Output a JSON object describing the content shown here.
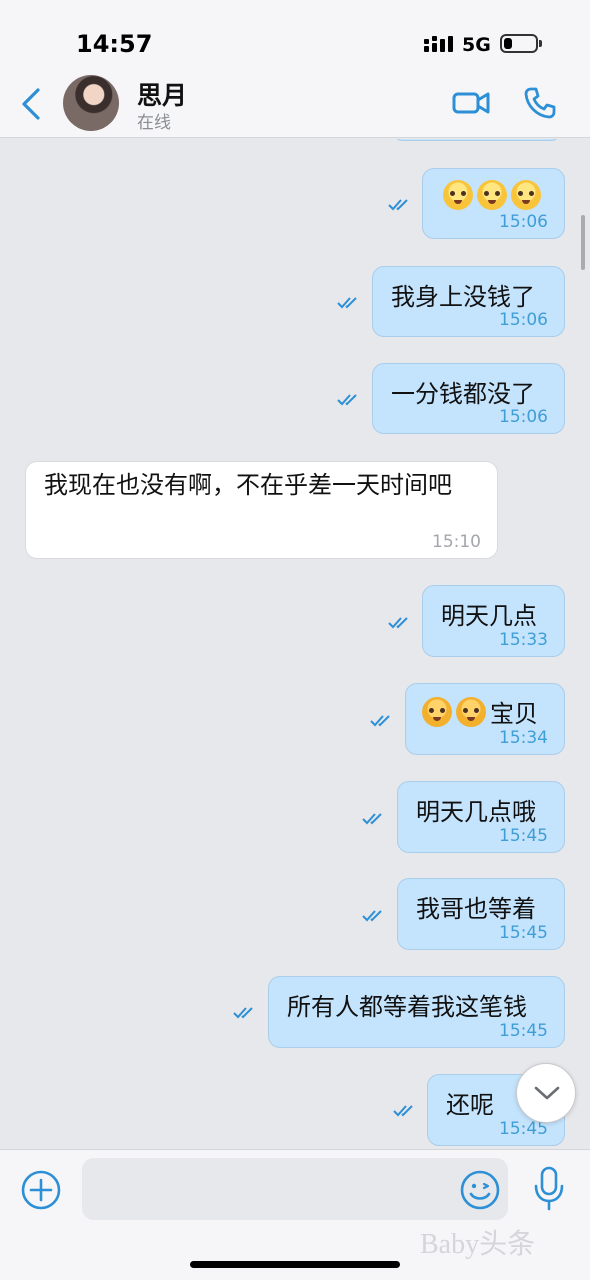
{
  "status_bar": {
    "time": "14:57",
    "network": "5G",
    "battery_level": 0.25
  },
  "header": {
    "contact_name": "思月",
    "contact_status": "在线",
    "back_icon": "chevron-left-icon",
    "video_icon": "video-camera-icon",
    "phone_icon": "phone-icon"
  },
  "messages": [
    {
      "dir": "out",
      "emoji": [
        "cry-emoji",
        "cry-emoji",
        "cry-emoji"
      ],
      "text": "",
      "time": "15:06"
    },
    {
      "dir": "out",
      "text": "我身上没钱了",
      "time": "15:06"
    },
    {
      "dir": "out",
      "text": "一分钱都没了",
      "time": "15:06"
    },
    {
      "dir": "in",
      "text": "我现在也没有啊，不在乎差一天时间吧",
      "time": "15:10"
    },
    {
      "dir": "out",
      "text": "明天几点",
      "time": "15:33"
    },
    {
      "dir": "out",
      "emoji": [
        "sob-emoji",
        "sob-emoji"
      ],
      "text": "宝贝",
      "time": "15:34"
    },
    {
      "dir": "out",
      "text": "明天几点哦",
      "time": "15:45"
    },
    {
      "dir": "out",
      "text": "我哥也等着",
      "time": "15:45"
    },
    {
      "dir": "out",
      "text": "所有人都等着我这笔钱",
      "time": "15:45"
    },
    {
      "dir": "out",
      "text": "还呢",
      "time": "15:45"
    }
  ],
  "input": {
    "value": "",
    "placeholder": ""
  },
  "colors": {
    "outgoing_bubble": "#c4e3fd",
    "incoming_bubble": "#ffffff",
    "accent": "#2d8fd5"
  },
  "watermark": "Baby头条"
}
